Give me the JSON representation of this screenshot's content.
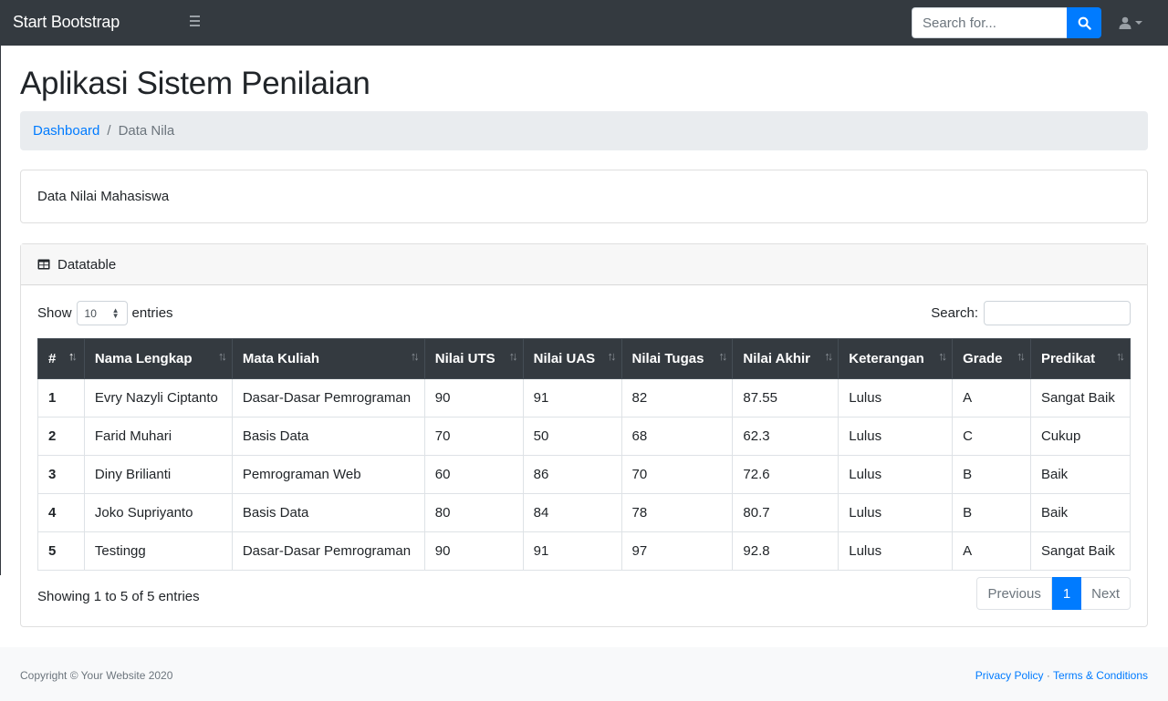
{
  "navbar": {
    "brand": "Start Bootstrap",
    "search_placeholder": "Search for...",
    "icons": [
      "bars-icon",
      "search-icon",
      "user-icon",
      "caret-down-icon"
    ]
  },
  "page": {
    "title": "Aplikasi Sistem Penilaian",
    "breadcrumb": {
      "link": "Dashboard",
      "separator": "/",
      "active": "Data Nila"
    },
    "info_card": "Data Nilai Mahasiswa"
  },
  "datatable": {
    "header_title": "Datatable",
    "length_show": "Show",
    "length_value": "10",
    "length_entries": "entries",
    "search_label": "Search:",
    "columns": [
      "#",
      "Nama Lengkap",
      "Mata Kuliah",
      "Nilai UTS",
      "Nilai UAS",
      "Nilai Tugas",
      "Nilai Akhir",
      "Keterangan",
      "Grade",
      "Predikat"
    ],
    "rows": [
      [
        "1",
        "Evry Nazyli Ciptanto",
        "Dasar-Dasar Pemrograman",
        "90",
        "91",
        "82",
        "87.55",
        "Lulus",
        "A",
        "Sangat Baik"
      ],
      [
        "2",
        "Farid Muhari",
        "Basis Data",
        "70",
        "50",
        "68",
        "62.3",
        "Lulus",
        "C",
        "Cukup"
      ],
      [
        "3",
        "Diny Brilianti",
        "Pemrograman Web",
        "60",
        "86",
        "70",
        "72.6",
        "Lulus",
        "B",
        "Baik"
      ],
      [
        "4",
        "Joko Supriyanto",
        "Basis Data",
        "80",
        "84",
        "78",
        "80.7",
        "Lulus",
        "B",
        "Baik"
      ],
      [
        "5",
        "Testingg",
        "Dasar-Dasar Pemrograman",
        "90",
        "91",
        "97",
        "92.8",
        "Lulus",
        "A",
        "Sangat Baik"
      ]
    ],
    "info": "Showing 1 to 5 of 5 entries",
    "pagination": {
      "previous": "Previous",
      "current": "1",
      "next": "Next"
    }
  },
  "footer": {
    "copyright": "Copyright © Your Website 2020",
    "privacy": "Privacy Policy",
    "separator": "·",
    "terms": "Terms & Conditions"
  },
  "colors": {
    "navbar": "#343a40",
    "accent": "#007bff",
    "table_header": "#343a40"
  }
}
